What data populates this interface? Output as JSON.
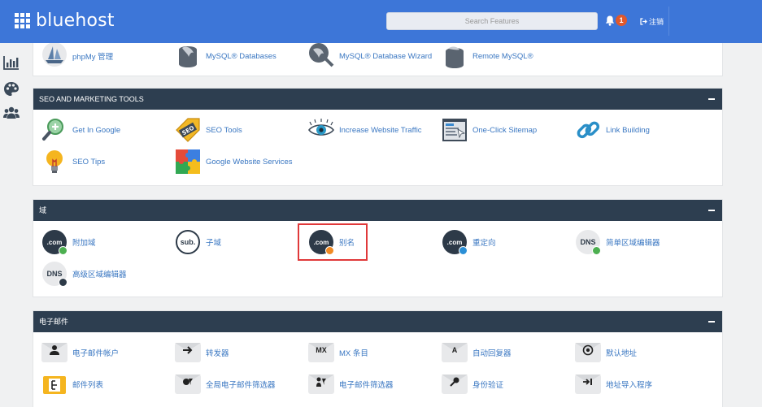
{
  "header": {
    "brand": "bluehost",
    "search_placeholder": "Search Features",
    "notification_count": "1",
    "logout_label": "注销"
  },
  "panels": {
    "database": {
      "items": [
        "phpMy 管理",
        "MySQL® Databases",
        "MySQL® Database Wizard",
        "Remote MySQL®"
      ]
    },
    "seo": {
      "title": "SEO AND MARKETING TOOLS",
      "items": [
        "Get In Google",
        "SEO Tools",
        "Increase Website Traffic",
        "One-Click Sitemap",
        "Link Building",
        "SEO Tips",
        "Google Website Services"
      ]
    },
    "domains": {
      "title": "域",
      "items": [
        "附加域",
        "子域",
        "别名",
        "重定向",
        "简单区域编辑器",
        "高级区域编辑器"
      ],
      "icon_text": [
        ".com",
        "sub.",
        ".com",
        ".com",
        "DNS",
        "DNS"
      ]
    },
    "email": {
      "title": "电子邮件",
      "items": [
        "电子邮件帐户",
        "转发器",
        "MX 条目",
        "自动回复器",
        "默认地址",
        "邮件列表",
        "全局电子邮件筛选器",
        "电子邮件筛选器",
        "身份验证",
        "地址导入程序"
      ],
      "icon_text": [
        "MX",
        "A"
      ]
    }
  },
  "colors": {
    "topbar": "#3d76d8",
    "panel_header": "#2d3e50",
    "link": "#3a77c2",
    "highlight": "#e0393a"
  }
}
